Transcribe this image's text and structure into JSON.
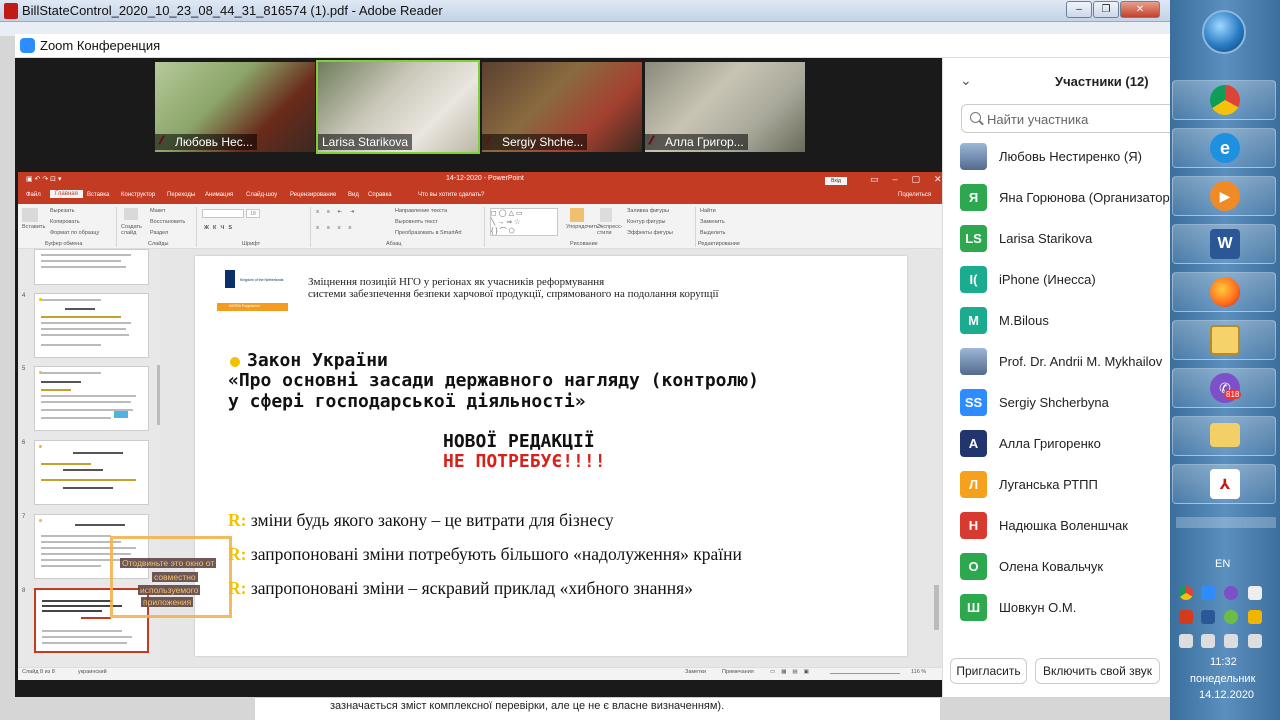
{
  "reader": {
    "title": "BillStateControl_2020_10_23_08_44_31_816574 (1).pdf - Adobe Reader",
    "window_controls": [
      "–",
      "❐",
      "✕"
    ],
    "footer_text": "зазначається зміст комплексної перевірки, але це не є власне визначенням)."
  },
  "zoom": {
    "title": "Zoom Конференция",
    "videos": [
      {
        "name": "Любовь Нес...",
        "muted": true
      },
      {
        "name": "Larisa Starikova",
        "muted": false
      },
      {
        "name": "Sergiy Shche...",
        "muted": true
      },
      {
        "name": "Алла Григор...",
        "muted": true
      }
    ],
    "participants_panel": {
      "title": "Участники (12)",
      "search_placeholder": "Найти участника",
      "participants": [
        {
          "initials": "",
          "name": "Любовь Нестиренко (Я)",
          "color": "#5a7bb0",
          "photo": true
        },
        {
          "initials": "Я",
          "name": "Яна Горюнова (Организатор)",
          "color": "#2ea84f"
        },
        {
          "initials": "LS",
          "name": "Larisa Starikova",
          "color": "#2ea84f"
        },
        {
          "initials": "I(",
          "name": "iPhone (Инесса)",
          "color": "#1bab8f"
        },
        {
          "initials": "M",
          "name": "M.Bilous",
          "color": "#1bab8f"
        },
        {
          "initials": "",
          "name": "Prof. Dr. Andrii M. Mykhailov",
          "color": "#c9a27e",
          "photo": true
        },
        {
          "initials": "SS",
          "name": "Sergiy Shcherbyna",
          "color": "#2d8cff"
        },
        {
          "initials": "А",
          "name": "Алла Григоренко",
          "color": "#23356e"
        },
        {
          "initials": "Л",
          "name": "Луганська РТПП",
          "color": "#f5a11b"
        },
        {
          "initials": "Н",
          "name": "Надюшка Воленшчак",
          "color": "#d93a2f"
        },
        {
          "initials": "О",
          "name": "Олена Ковальчук",
          "color": "#2ea84f"
        },
        {
          "initials": "Ш",
          "name": "Шовкун О.М.",
          "color": "#2ea84f"
        }
      ],
      "invite_label": "Пригласить",
      "unmute_label": "Включить свой звук"
    }
  },
  "ppt": {
    "title": "14-12-2020 - PowerPoint",
    "signin": "Вхід",
    "tabs": [
      "Файл",
      "Главная",
      "Вставка",
      "Конструктор",
      "Переходы",
      "Анимация",
      "Слайд-шоу",
      "Рецензирование",
      "Вид",
      "Справка",
      "Что вы хотите сделать?",
      "Поделиться"
    ],
    "ribbon": {
      "paste": "Вставить",
      "cut": "Вырезать",
      "copy": "Копировать",
      "format_painter": "Формат по образцу",
      "clipboard": "Буфер обмена",
      "new_slide": "Создать слайд",
      "layout": "Макет",
      "reset": "Восстановить",
      "section": "Раздел",
      "slides": "Слайды",
      "font": "Шрифт",
      "paragraph": "Абзац",
      "text_direction": "Направление текста",
      "align_text": "Выровнять текст",
      "smartart": "Преобразовать в SmartArt",
      "arrange": "Упорядочить",
      "quick_styles": "Экспресс-стили",
      "shape_fill": "Заливка фигуры",
      "shape_outline": "Контур фигуры",
      "shape_effects": "Эффекты фигуры",
      "drawing": "Рисование",
      "find": "Найти",
      "replace": "Заменить",
      "select": "Выделить",
      "editing": "Редактирование",
      "font_size": "18"
    },
    "thumbnail_numbers": [
      "4",
      "5",
      "6",
      "7",
      "8"
    ],
    "status": {
      "slide": "Слайд 8 из 8",
      "language": "украинский",
      "notes": "Заметки",
      "comments": "Примечания",
      "zoom": "116 %"
    },
    "slide": {
      "logo_text": "Kingdom of the Netherlands",
      "logo_bar_text": "MATRA Programme",
      "header_line1": "Зміцнення позицій НГО у регіонах як учасників реформування",
      "header_line2": "системи забезпечення безпеки харчової продукції, спрямованого на подолання корупції",
      "law_line1": "Закон України",
      "law_line2": "«Про основні засади державного нагляду (контролю)",
      "law_line3": "у сфері господарської діяльності»",
      "note_line1": "НОВОЇ РЕДАКЦІЇ",
      "note_line2": "НЕ ПОТРЕБУЄ!!!!",
      "note_color_1": "#111111",
      "note_color_2": "#d8211b",
      "r_mark": "R:",
      "r_lines": [
        "зміни будь якого закону – це витрати для бізнесу",
        "запропоновані зміни потребують більшого «надолуження» країни",
        "запропоновані зміни – яскравий приклад «хибного знання»"
      ]
    },
    "share_overlay": [
      "Отодвиньте это окно от",
      "совместно",
      "используемого",
      "приложения"
    ]
  },
  "taskbar": {
    "language": "EN",
    "time": "11:32",
    "day": "понедельник",
    "date": "14.12.2020",
    "vibe_badge": "818",
    "apps": [
      "chrome-icon",
      "ie-icon",
      "media-player-icon",
      "word-icon",
      "firefox-icon",
      "scheduler-icon",
      "viber-icon",
      "explorer-icon",
      "acrobat-icon"
    ]
  }
}
